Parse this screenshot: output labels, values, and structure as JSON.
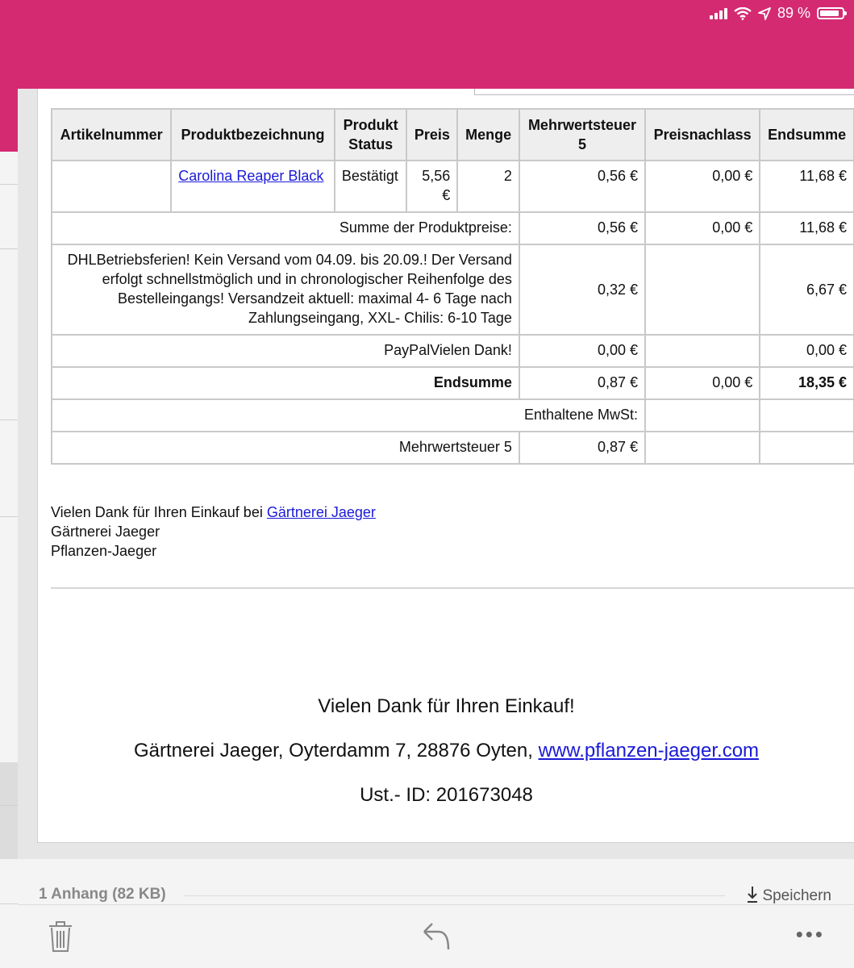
{
  "status_bar": {
    "battery": "89 %"
  },
  "table": {
    "headers": [
      "Artikelnummer",
      "Produktbezeichnung",
      "Produkt Status",
      "Preis",
      "Menge",
      "Mehrwertsteuer 5",
      "Preisnachlass",
      "Endsumme"
    ],
    "product": {
      "artikelnummer": "",
      "name": "Carolina Reaper Black",
      "status": "Bestätigt",
      "preis": "5,56 €",
      "menge": "2",
      "mwst": "0,56 €",
      "nachlass": "0,00 €",
      "endsumme": "11,68 €"
    },
    "summe": {
      "label": "Summe der Produktpreise:",
      "mwst": "0,56 €",
      "nachlass": "0,00 €",
      "endsumme": "11,68 €"
    },
    "versand": {
      "label": "DHLBetriebsferien! Kein Versand vom 04.09. bis 20.09.! Der Versand erfolgt schnellstmöglich und in chronologischer Reihenfolge des Bestelleingangs! Versandzeit aktuell: maximal 4- 6 Tage nach Zahlungseingang, XXL- Chilis: 6-10 Tage",
      "mwst": "0,32 €",
      "nachlass": "",
      "endsumme": "6,67 €"
    },
    "paypal": {
      "label": "PayPalVielen Dank!",
      "mwst": "0,00 €",
      "nachlass": "",
      "endsumme": "0,00 €"
    },
    "total": {
      "label": "Endsumme",
      "mwst": "0,87 €",
      "nachlass": "0,00 €",
      "endsumme": "18,35 €"
    },
    "enthaltene": {
      "label": "Enthaltene MwSt:"
    },
    "mwst_row": {
      "label": "Mehrwertsteuer 5",
      "value": "0,87 €"
    }
  },
  "thanks": {
    "line1_prefix": "Vielen Dank für Ihren Einkauf bei ",
    "line1_link": "Gärtnerei Jaeger",
    "line2": "Gärtnerei Jaeger",
    "line3": "Pflanzen-Jaeger"
  },
  "footer": {
    "thanks": "Vielen Dank für Ihren Einkauf!",
    "address": "Gärtnerei Jaeger, Oyterdamm 7, 28876 Oyten, ",
    "website": "www.pflanzen-jaeger.com",
    "ust": "Ust.- ID: 201673048"
  },
  "attachment": {
    "label": "1 Anhang (82 KB)",
    "save": "Speichern"
  },
  "icons": [
    "signal-icon",
    "wifi-icon",
    "location-icon",
    "battery-icon",
    "download-icon",
    "trash-icon",
    "reply-icon",
    "more-icon"
  ],
  "colors": {
    "brand": "#d42a72",
    "link": "#1a1ad8"
  }
}
